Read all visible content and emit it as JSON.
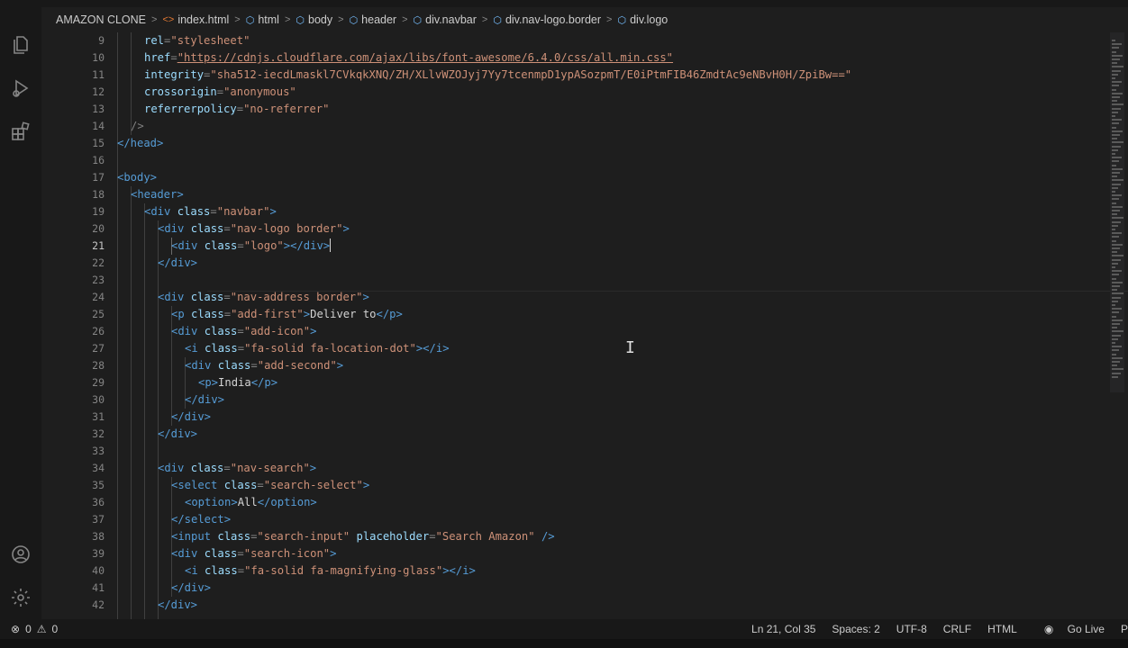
{
  "breadcrumb": [
    {
      "label": "AMAZON CLONE",
      "icon": ""
    },
    {
      "label": "index.html",
      "icon": "html-file-icon"
    },
    {
      "label": "html",
      "icon": "element-icon"
    },
    {
      "label": "body",
      "icon": "element-icon"
    },
    {
      "label": "header",
      "icon": "element-icon"
    },
    {
      "label": "div.navbar",
      "icon": "element-icon"
    },
    {
      "label": "div.nav-logo.border",
      "icon": "element-icon"
    },
    {
      "label": "div.logo",
      "icon": "element-icon"
    }
  ],
  "active_line": 21,
  "line_numbers": [
    "9",
    "10",
    "11",
    "12",
    "13",
    "14",
    "15",
    "16",
    "17",
    "18",
    "19",
    "20",
    "21",
    "22",
    "23",
    "24",
    "25",
    "26",
    "27",
    "28",
    "29",
    "30",
    "31",
    "32",
    "33",
    "34",
    "35",
    "36",
    "37",
    "38",
    "39",
    "40",
    "41",
    "42"
  ],
  "code": {
    "l9_attr": "rel",
    "l9_val": "\"stylesheet\"",
    "l10_attr": "href",
    "l10_val": "\"https://cdnjs.cloudflare.com/ajax/libs/font-awesome/6.4.0/css/all.min.css\"",
    "l11_attr": "integrity",
    "l11_val": "\"sha512-iecdLmaskl7CVkqkXNQ/ZH/XLlvWZOJyj7Yy7tcenmpD1ypASozpmT/E0iPtmFIB46ZmdtAc9eNBvH0H/ZpiBw==\"",
    "l12_attr": "crossorigin",
    "l12_val": "\"anonymous\"",
    "l13_attr": "referrerpolicy",
    "l13_val": "\"no-referrer\"",
    "l14": "/>",
    "l15": "</head>",
    "l17": "<body>",
    "l18": "<header>",
    "l19_open": "<div",
    "l19_attr": "class",
    "l19_val": "\"navbar\"",
    "l19_close": ">",
    "l20_open": "<div",
    "l20_attr": "class",
    "l20_val": "\"nav-logo border\"",
    "l20_close": ">",
    "l21_open": "<div",
    "l21_attr": "class",
    "l21_val": "\"logo\"",
    "l21_close": "></div>",
    "l22": "</div>",
    "l24_open": "<div",
    "l24_attr": "class",
    "l24_val": "\"nav-address border\"",
    "l24_close": ">",
    "l25_open": "<p",
    "l25_attr": "class",
    "l25_val": "\"add-first\"",
    "l25_gt": ">",
    "l25_text": "Deliver to",
    "l25_close": "</p>",
    "l26_open": "<div",
    "l26_attr": "class",
    "l26_val": "\"add-icon\"",
    "l26_close": ">",
    "l27_open": "<i",
    "l27_attr": "class",
    "l27_val": "\"fa-solid fa-location-dot\"",
    "l27_close": "></i>",
    "l28_open": "<div",
    "l28_attr": "class",
    "l28_val": "\"add-second\"",
    "l28_close": ">",
    "l29_open": "<p>",
    "l29_text": "India",
    "l29_close": "</p>",
    "l30": "</div>",
    "l31": "</div>",
    "l32": "</div>",
    "l34_open": "<div",
    "l34_attr": "class",
    "l34_val": "\"nav-search\"",
    "l34_close": ">",
    "l35_open": "<select",
    "l35_attr": "class",
    "l35_val": "\"search-select\"",
    "l35_close": ">",
    "l36_open": "<option>",
    "l36_text": "All",
    "l36_close": "</option>",
    "l37": "</select>",
    "l38_open": "<input",
    "l38_attr": "class",
    "l38_val": "\"search-input\"",
    "l38_attr2": "placeholder",
    "l38_val2": "\"Search Amazon\"",
    "l38_close": "/>",
    "l39_open": "<div",
    "l39_attr": "class",
    "l39_val": "\"search-icon\"",
    "l39_close": ">",
    "l40_open": "<i",
    "l40_attr": "class",
    "l40_val": "\"fa-solid fa-magnifying-glass\"",
    "l40_close": "></i>",
    "l41": "</div>",
    "l42": "</div>"
  },
  "status": {
    "errors": "0",
    "warnings": "0",
    "position": "Ln 21, Col 35",
    "spaces": "Spaces: 2",
    "encoding": "UTF-8",
    "eol": "CRLF",
    "language": "HTML",
    "live": "Go Live",
    "overflow": "P"
  }
}
